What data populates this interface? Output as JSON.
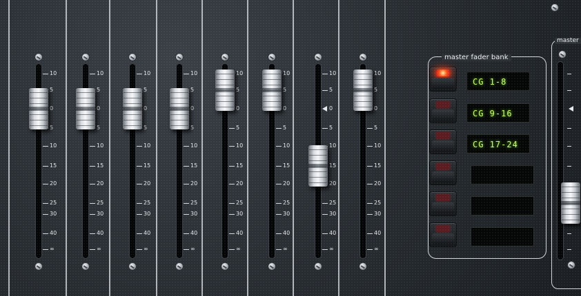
{
  "console": {
    "scale_labels": [
      "10",
      "5",
      "0",
      "5",
      "10",
      "15",
      "20",
      "25",
      "30",
      "40",
      "∞"
    ],
    "fader_bank": {
      "title": "master fader bank",
      "buttons": [
        {
          "led": "on"
        },
        {
          "led": "off"
        },
        {
          "led": "off"
        },
        {
          "led": "off"
        },
        {
          "led": "off"
        },
        {
          "led": "off"
        }
      ],
      "displays": [
        "CG 1-8",
        "CG 9-16",
        "CG 17-24",
        "",
        "",
        ""
      ]
    },
    "master": {
      "label": "master"
    },
    "faders": [
      {
        "level_db": 0
      },
      {
        "level_db": 0
      },
      {
        "level_db": 0
      },
      {
        "level_db": 0
      },
      {
        "level_db": 5
      },
      {
        "level_db": 5
      },
      {
        "level_db": -15
      },
      {
        "level_db": 5
      }
    ],
    "master_fader": {
      "level_db": -25
    },
    "colors": {
      "panel": "#2b3035",
      "divider": "#c9ced3",
      "led_on": "#ff4a1a",
      "display_text": "#c9ff66"
    }
  }
}
